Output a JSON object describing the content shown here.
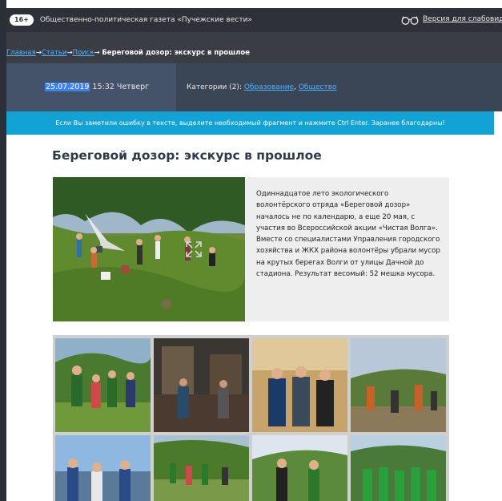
{
  "header": {
    "age_badge": "16+",
    "site_title": "Общественно-политическая газета «Пучежские вести»",
    "accessible_label": "Версия для слабовидя",
    "accessible_icon": "glasses-icon"
  },
  "breadcrumb": {
    "items": [
      "Главная",
      "Статьи",
      "Поиск"
    ],
    "separator": "→",
    "current": "Береговой дозор: экскурс в прошлое"
  },
  "meta": {
    "date": "25.07.2019",
    "time_day": " 15:32 Четверг",
    "categories_label": "Категории (2): ",
    "categories": [
      "Образование",
      "Общество"
    ],
    "categories_separator": ", "
  },
  "notice": "Если Вы заметили ошибку в тексте, выделите необходимый фрагмент и нажмите Ctrl Enter. Заранее благодарны!",
  "article": {
    "title": "Береговой дозор: экскурс в прошлое",
    "lead": "Одиннадцатое лето экологического волонтёрского отряда «Береговой дозор» началось не по календарю, а еще 20 мая, с участия во Всероссийской акции «Чистая Волга». Вместе со специалистами Управления городского хозяйства и ЖКХ района волонтёры убрали мусор на крутых берегах Волги от улицы Дачной до стадиона. Результат весомый: 52 мешка мусора."
  },
  "colors": {
    "topbar": "#2e3138",
    "breadcrumb_bg": "#3a3d44",
    "meta_bg": "#3a4656",
    "notice_bg": "#13a2d4",
    "link": "#4fb3ff"
  }
}
